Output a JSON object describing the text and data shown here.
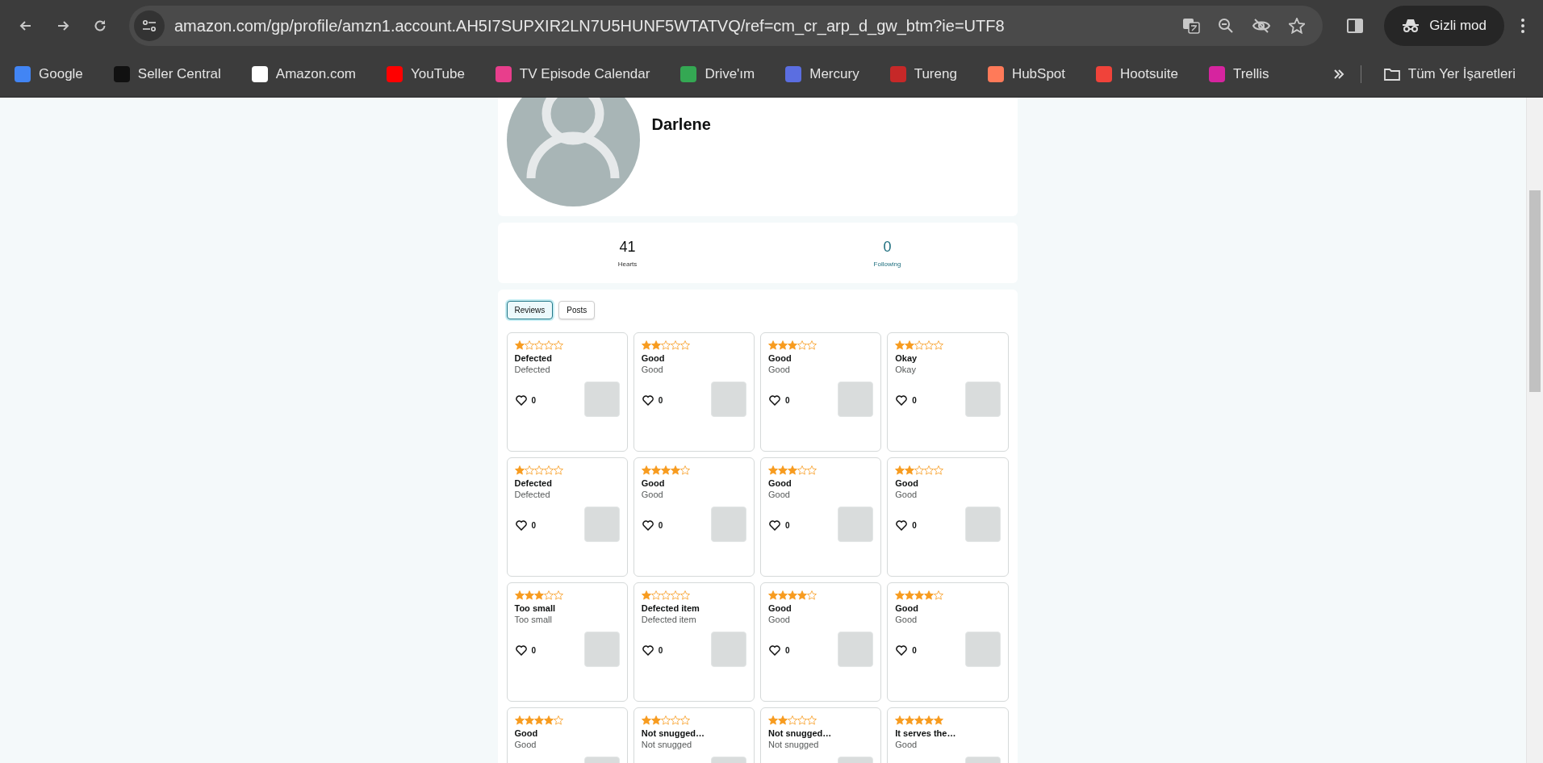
{
  "browser": {
    "url": "amazon.com/gp/profile/amzn1.account.AH5I7SUPXIR2LN7U5HUNF5WTATVQ/ref=cm_cr_arp_d_gw_btm?ie=UTF8",
    "incognito_label": "Gizli mod",
    "bookmarks": [
      {
        "label": "Google",
        "color": "#4285f4"
      },
      {
        "label": "Seller Central",
        "color": "#111111"
      },
      {
        "label": "Amazon.com",
        "color": "#ffffff"
      },
      {
        "label": "YouTube",
        "color": "#ff0000"
      },
      {
        "label": "TV Episode Calendar",
        "color": "#e83e8c"
      },
      {
        "label": "Drive'ım",
        "color": "#34a853"
      },
      {
        "label": "Mercury",
        "color": "#5b6ee1"
      },
      {
        "label": "Tureng",
        "color": "#c62828"
      },
      {
        "label": "HubSpot",
        "color": "#ff7a59"
      },
      {
        "label": "Hootsuite",
        "color": "#f0433a"
      },
      {
        "label": "Trellis",
        "color": "#d6249f"
      }
    ],
    "all_bookmarks": "Tüm Yer İşaretleri"
  },
  "profile": {
    "name": "Darlene"
  },
  "stats": [
    {
      "value": "41",
      "label": "Hearts",
      "kind": "plain"
    },
    {
      "value": "0",
      "label": "Following",
      "kind": "link"
    }
  ],
  "tabs": [
    {
      "label": "Reviews",
      "selected": true
    },
    {
      "label": "Posts",
      "selected": false
    }
  ],
  "reviews": [
    {
      "stars": 1,
      "title": "Defected",
      "body": "Defected",
      "likes": "0"
    },
    {
      "stars": 2,
      "title": "Good",
      "body": "Good",
      "likes": "0"
    },
    {
      "stars": 3,
      "title": "Good",
      "body": "Good",
      "likes": "0"
    },
    {
      "stars": 2,
      "title": "Okay",
      "body": "Okay",
      "likes": "0"
    },
    {
      "stars": 1,
      "title": "Defected",
      "body": "Defected",
      "likes": "0"
    },
    {
      "stars": 4,
      "title": "Good",
      "body": "Good",
      "likes": "0"
    },
    {
      "stars": 3,
      "title": "Good",
      "body": "Good",
      "likes": "0"
    },
    {
      "stars": 2,
      "title": "Good",
      "body": "Good",
      "likes": "0"
    },
    {
      "stars": 3,
      "title": "Too small",
      "body": "Too small",
      "likes": "0"
    },
    {
      "stars": 1,
      "title": "Defected item",
      "body": "Defected item",
      "likes": "0"
    },
    {
      "stars": 4,
      "title": "Good",
      "body": "Good",
      "likes": "0"
    },
    {
      "stars": 4,
      "title": "Good",
      "body": "Good",
      "likes": "0"
    },
    {
      "stars": 4,
      "title": "Good",
      "body": "Good"
    },
    {
      "stars": 2,
      "title": "Not snugged…",
      "body": "Not snugged"
    },
    {
      "stars": 2,
      "title": "Not snugged…",
      "body": "Not snugged"
    },
    {
      "stars": 5,
      "title": "It serves the…",
      "body": "Good"
    }
  ]
}
